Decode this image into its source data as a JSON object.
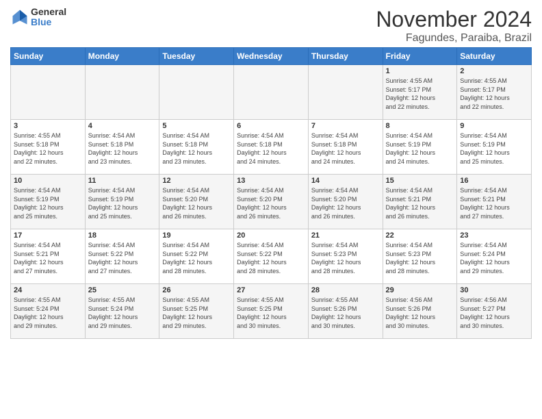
{
  "logo": {
    "general": "General",
    "blue": "Blue"
  },
  "header": {
    "month": "November 2024",
    "location": "Fagundes, Paraiba, Brazil"
  },
  "weekdays": [
    "Sunday",
    "Monday",
    "Tuesday",
    "Wednesday",
    "Thursday",
    "Friday",
    "Saturday"
  ],
  "weeks": [
    [
      {
        "day": "",
        "sunrise": "",
        "sunset": "",
        "daylight": ""
      },
      {
        "day": "",
        "sunrise": "",
        "sunset": "",
        "daylight": ""
      },
      {
        "day": "",
        "sunrise": "",
        "sunset": "",
        "daylight": ""
      },
      {
        "day": "",
        "sunrise": "",
        "sunset": "",
        "daylight": ""
      },
      {
        "day": "",
        "sunrise": "",
        "sunset": "",
        "daylight": ""
      },
      {
        "day": "1",
        "sunrise": "Sunrise: 4:55 AM",
        "sunset": "Sunset: 5:17 PM",
        "daylight": "Daylight: 12 hours and 22 minutes."
      },
      {
        "day": "2",
        "sunrise": "Sunrise: 4:55 AM",
        "sunset": "Sunset: 5:17 PM",
        "daylight": "Daylight: 12 hours and 22 minutes."
      }
    ],
    [
      {
        "day": "3",
        "sunrise": "Sunrise: 4:55 AM",
        "sunset": "Sunset: 5:18 PM",
        "daylight": "Daylight: 12 hours and 22 minutes."
      },
      {
        "day": "4",
        "sunrise": "Sunrise: 4:54 AM",
        "sunset": "Sunset: 5:18 PM",
        "daylight": "Daylight: 12 hours and 23 minutes."
      },
      {
        "day": "5",
        "sunrise": "Sunrise: 4:54 AM",
        "sunset": "Sunset: 5:18 PM",
        "daylight": "Daylight: 12 hours and 23 minutes."
      },
      {
        "day": "6",
        "sunrise": "Sunrise: 4:54 AM",
        "sunset": "Sunset: 5:18 PM",
        "daylight": "Daylight: 12 hours and 24 minutes."
      },
      {
        "day": "7",
        "sunrise": "Sunrise: 4:54 AM",
        "sunset": "Sunset: 5:18 PM",
        "daylight": "Daylight: 12 hours and 24 minutes."
      },
      {
        "day": "8",
        "sunrise": "Sunrise: 4:54 AM",
        "sunset": "Sunset: 5:19 PM",
        "daylight": "Daylight: 12 hours and 24 minutes."
      },
      {
        "day": "9",
        "sunrise": "Sunrise: 4:54 AM",
        "sunset": "Sunset: 5:19 PM",
        "daylight": "Daylight: 12 hours and 25 minutes."
      }
    ],
    [
      {
        "day": "10",
        "sunrise": "Sunrise: 4:54 AM",
        "sunset": "Sunset: 5:19 PM",
        "daylight": "Daylight: 12 hours and 25 minutes."
      },
      {
        "day": "11",
        "sunrise": "Sunrise: 4:54 AM",
        "sunset": "Sunset: 5:19 PM",
        "daylight": "Daylight: 12 hours and 25 minutes."
      },
      {
        "day": "12",
        "sunrise": "Sunrise: 4:54 AM",
        "sunset": "Sunset: 5:20 PM",
        "daylight": "Daylight: 12 hours and 26 minutes."
      },
      {
        "day": "13",
        "sunrise": "Sunrise: 4:54 AM",
        "sunset": "Sunset: 5:20 PM",
        "daylight": "Daylight: 12 hours and 26 minutes."
      },
      {
        "day": "14",
        "sunrise": "Sunrise: 4:54 AM",
        "sunset": "Sunset: 5:20 PM",
        "daylight": "Daylight: 12 hours and 26 minutes."
      },
      {
        "day": "15",
        "sunrise": "Sunrise: 4:54 AM",
        "sunset": "Sunset: 5:21 PM",
        "daylight": "Daylight: 12 hours and 26 minutes."
      },
      {
        "day": "16",
        "sunrise": "Sunrise: 4:54 AM",
        "sunset": "Sunset: 5:21 PM",
        "daylight": "Daylight: 12 hours and 27 minutes."
      }
    ],
    [
      {
        "day": "17",
        "sunrise": "Sunrise: 4:54 AM",
        "sunset": "Sunset: 5:21 PM",
        "daylight": "Daylight: 12 hours and 27 minutes."
      },
      {
        "day": "18",
        "sunrise": "Sunrise: 4:54 AM",
        "sunset": "Sunset: 5:22 PM",
        "daylight": "Daylight: 12 hours and 27 minutes."
      },
      {
        "day": "19",
        "sunrise": "Sunrise: 4:54 AM",
        "sunset": "Sunset: 5:22 PM",
        "daylight": "Daylight: 12 hours and 28 minutes."
      },
      {
        "day": "20",
        "sunrise": "Sunrise: 4:54 AM",
        "sunset": "Sunset: 5:22 PM",
        "daylight": "Daylight: 12 hours and 28 minutes."
      },
      {
        "day": "21",
        "sunrise": "Sunrise: 4:54 AM",
        "sunset": "Sunset: 5:23 PM",
        "daylight": "Daylight: 12 hours and 28 minutes."
      },
      {
        "day": "22",
        "sunrise": "Sunrise: 4:54 AM",
        "sunset": "Sunset: 5:23 PM",
        "daylight": "Daylight: 12 hours and 28 minutes."
      },
      {
        "day": "23",
        "sunrise": "Sunrise: 4:54 AM",
        "sunset": "Sunset: 5:24 PM",
        "daylight": "Daylight: 12 hours and 29 minutes."
      }
    ],
    [
      {
        "day": "24",
        "sunrise": "Sunrise: 4:55 AM",
        "sunset": "Sunset: 5:24 PM",
        "daylight": "Daylight: 12 hours and 29 minutes."
      },
      {
        "day": "25",
        "sunrise": "Sunrise: 4:55 AM",
        "sunset": "Sunset: 5:24 PM",
        "daylight": "Daylight: 12 hours and 29 minutes."
      },
      {
        "day": "26",
        "sunrise": "Sunrise: 4:55 AM",
        "sunset": "Sunset: 5:25 PM",
        "daylight": "Daylight: 12 hours and 29 minutes."
      },
      {
        "day": "27",
        "sunrise": "Sunrise: 4:55 AM",
        "sunset": "Sunset: 5:25 PM",
        "daylight": "Daylight: 12 hours and 30 minutes."
      },
      {
        "day": "28",
        "sunrise": "Sunrise: 4:55 AM",
        "sunset": "Sunset: 5:26 PM",
        "daylight": "Daylight: 12 hours and 30 minutes."
      },
      {
        "day": "29",
        "sunrise": "Sunrise: 4:56 AM",
        "sunset": "Sunset: 5:26 PM",
        "daylight": "Daylight: 12 hours and 30 minutes."
      },
      {
        "day": "30",
        "sunrise": "Sunrise: 4:56 AM",
        "sunset": "Sunset: 5:27 PM",
        "daylight": "Daylight: 12 hours and 30 minutes."
      }
    ]
  ]
}
